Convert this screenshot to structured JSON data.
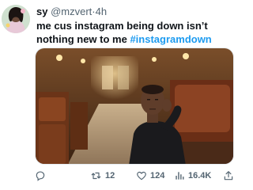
{
  "tweet": {
    "display_name": "sy",
    "handle": "@mzvert",
    "separator": "·",
    "time": "4h",
    "text": "me cus instagram being down isn’t nothing new to me",
    "hashtag": "#instagramdown"
  },
  "actions": {
    "replies": "",
    "retweets": "12",
    "likes": "124",
    "views": "16.4K"
  },
  "colors": {
    "link": "#1d9bf0",
    "muted": "#536471",
    "text": "#0f1419"
  }
}
